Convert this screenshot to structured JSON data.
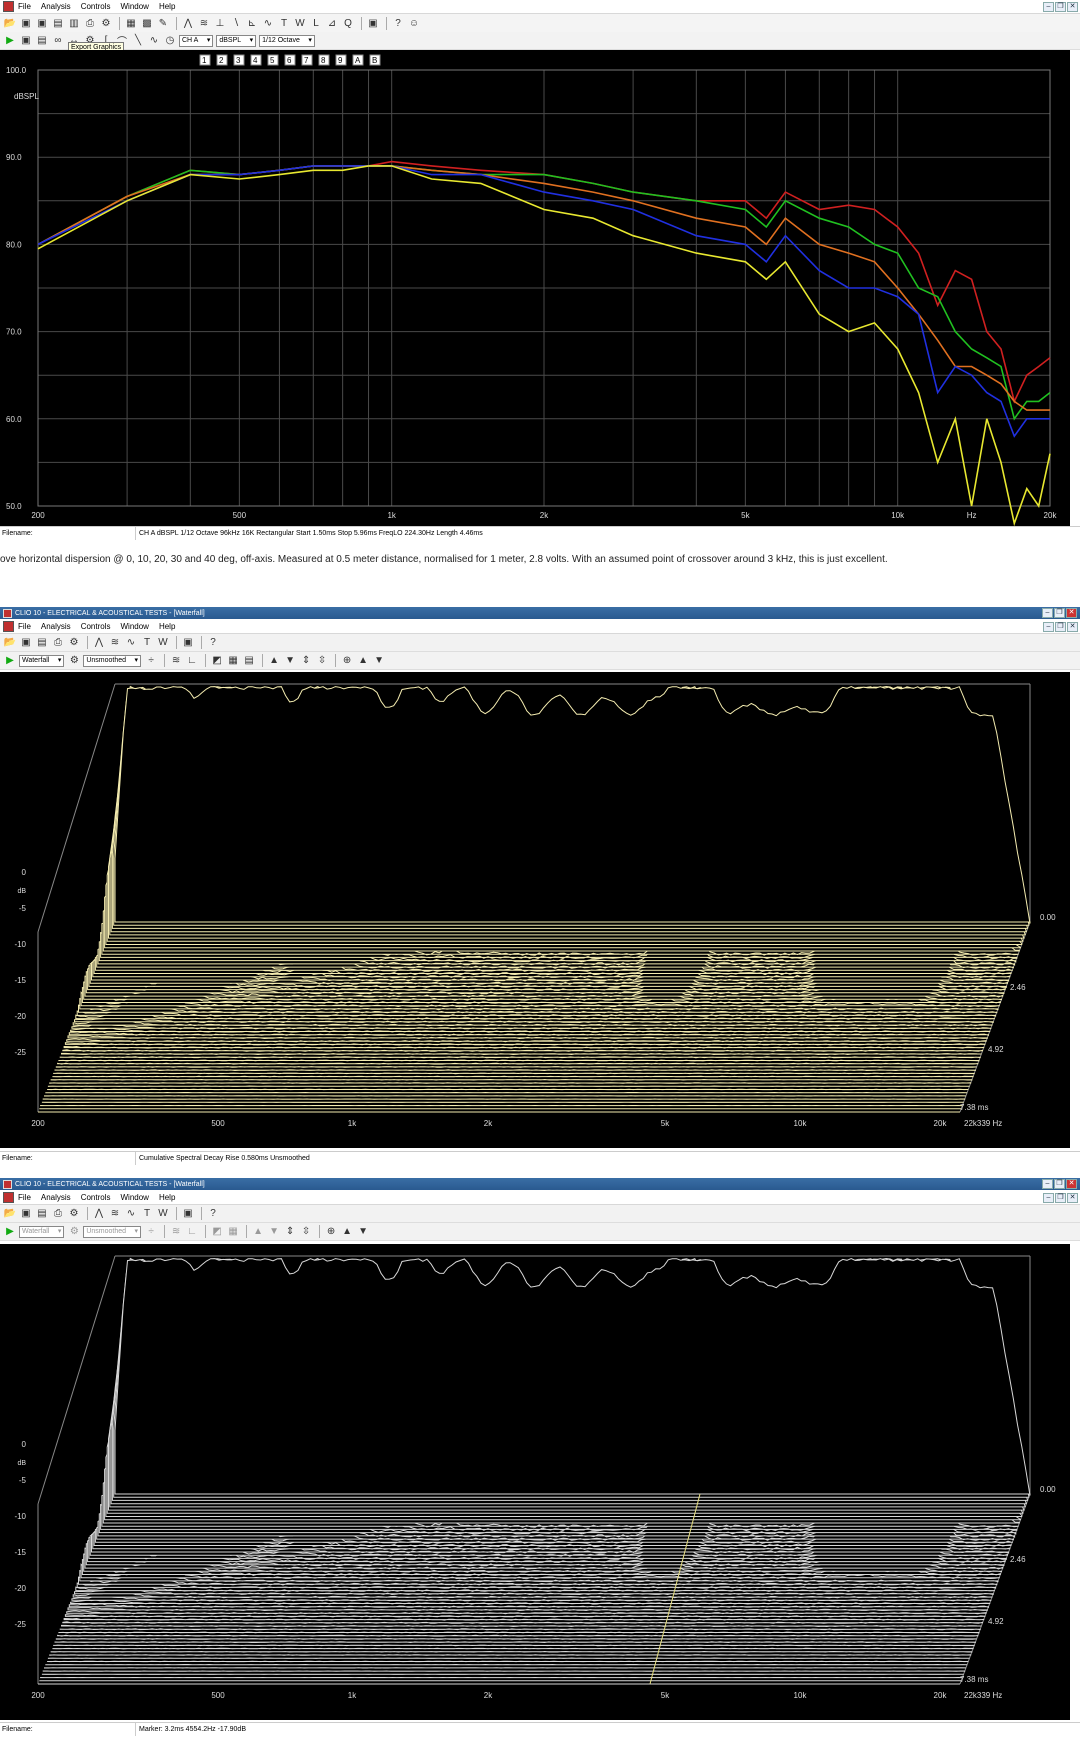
{
  "menu": [
    "File",
    "Analysis",
    "Controls",
    "Window",
    "Help"
  ],
  "panel1": {
    "channel": "CH A",
    "unit": "dBSPL",
    "smoothing": "1/12 Octave",
    "tooltip": "Export Graphics",
    "tab_labels": [
      "1",
      "2",
      "3",
      "4",
      "5",
      "6",
      "7",
      "8",
      "9",
      "A",
      "B"
    ],
    "status": {
      "filename_label": "Filename:",
      "info": "CH A   dBSPL   1/12 Octave   96kHz   16K   Rectangular   Start 1.50ms   Stop 5.96ms   FreqLO 224.30Hz   Length 4.46ms"
    }
  },
  "caption": "ove horizontal dispersion @ 0, 10, 20, 30 and 40 deg, off-axis. Measured at 0.5 meter distance, normalised for 1 meter, 2.8 volts. With an assumed point of crossover around 3 kHz, this is just excellent.",
  "panel2": {
    "window_title": "CLIO 10 - ELECTRICAL & ACOUSTICAL TESTS - [Waterfall]",
    "mode": "Waterfall",
    "smoothing": "Unsmoothed",
    "status": {
      "filename_label": "Filename:",
      "info": "Cumulative Spectral Decay   Rise 0.580ms   Unsmoothed"
    }
  },
  "panel3": {
    "window_title": "CLIO 10 - ELECTRICAL & ACOUSTICAL TESTS - [Waterfall]",
    "mode": "Waterfall",
    "smoothing": "Unsmoothed",
    "status": {
      "filename_label": "Filename:",
      "info": "Marker: 3.2ms  4554.2Hz  -17.90dB"
    }
  },
  "chart_data": [
    {
      "type": "line",
      "ylabel": "dBSPL",
      "ylim": [
        50,
        100
      ],
      "yticks": [
        "100.0",
        "90.0",
        "80.0",
        "70.0",
        "60.0",
        "50.0"
      ],
      "xscale": "log",
      "xlim": [
        200,
        20000
      ],
      "xticks": [
        "200",
        "500",
        "1k",
        "2k",
        "5k",
        "10k",
        "Hz",
        "20k"
      ],
      "x": [
        200,
        300,
        400,
        500,
        600,
        700,
        800,
        900,
        1000,
        1200,
        1500,
        2000,
        2500,
        3000,
        4000,
        5000,
        5500,
        6000,
        7000,
        8000,
        9000,
        10000,
        11000,
        12000,
        13000,
        14000,
        15000,
        16000,
        17000,
        18000,
        19000,
        20000
      ],
      "series": [
        {
          "color": "#d02020",
          "values": [
            80,
            85.5,
            88.5,
            88,
            88.5,
            89,
            89,
            89,
            89.5,
            89,
            88.5,
            88,
            87,
            86,
            85,
            85,
            83,
            86,
            84,
            84.5,
            84,
            82,
            79,
            73,
            77,
            76,
            70,
            68,
            62,
            65,
            66,
            67
          ]
        },
        {
          "color": "#20c020",
          "values": [
            80,
            85.5,
            88.5,
            88,
            88.5,
            89,
            89,
            89,
            89,
            88.5,
            88,
            88,
            87,
            86,
            85,
            84,
            82,
            85,
            83,
            82,
            80,
            79,
            75,
            74,
            70,
            68,
            67,
            66,
            60,
            62,
            62,
            63
          ]
        },
        {
          "color": "#e07020",
          "values": [
            80,
            85.5,
            88,
            88,
            88.5,
            89,
            89,
            89,
            89,
            88.5,
            88,
            87,
            86,
            85,
            83,
            82,
            80,
            83,
            80,
            79,
            78,
            75,
            72,
            69,
            66,
            66,
            65,
            64,
            62,
            61,
            61,
            61
          ]
        },
        {
          "color": "#2030e0",
          "values": [
            80,
            85,
            88,
            88,
            88.5,
            89,
            89,
            89,
            89,
            88,
            88,
            86,
            85,
            84,
            81,
            80,
            78,
            81,
            77,
            75,
            75,
            74,
            72,
            63,
            66,
            65,
            63,
            62,
            58,
            60,
            60,
            60
          ]
        },
        {
          "color": "#e8e830",
          "values": [
            79.5,
            85,
            88,
            87.5,
            88,
            88.5,
            88.5,
            89,
            89,
            87.5,
            87,
            84,
            83,
            81,
            79,
            78,
            76,
            78,
            72,
            70,
            71,
            68,
            63,
            55,
            60,
            50,
            60,
            55,
            48,
            52,
            50,
            56
          ]
        }
      ]
    },
    {
      "type": "area",
      "title": "Cumulative Spectral Decay",
      "ylabel": "dB",
      "yticks": [
        "0",
        "-5",
        "-10",
        "-15",
        "-20",
        "-25"
      ],
      "xticks": [
        "200",
        "500",
        "1k",
        "2k",
        "5k",
        "10k",
        "20k",
        "22k339 Hz"
      ],
      "zticks": [
        "0.00",
        "2.46",
        "4.92",
        "7.38 ms"
      ]
    },
    {
      "type": "area",
      "title": "Cumulative Spectral Decay",
      "ylabel": "dB",
      "yticks": [
        "0",
        "-5",
        "-10",
        "-15",
        "-20",
        "-25"
      ],
      "xticks": [
        "200",
        "500",
        "1k",
        "2k",
        "5k",
        "10k",
        "20k",
        "22k339 Hz"
      ],
      "zticks": [
        "0.00",
        "2.46",
        "4.92",
        "7.38 ms"
      ]
    }
  ]
}
